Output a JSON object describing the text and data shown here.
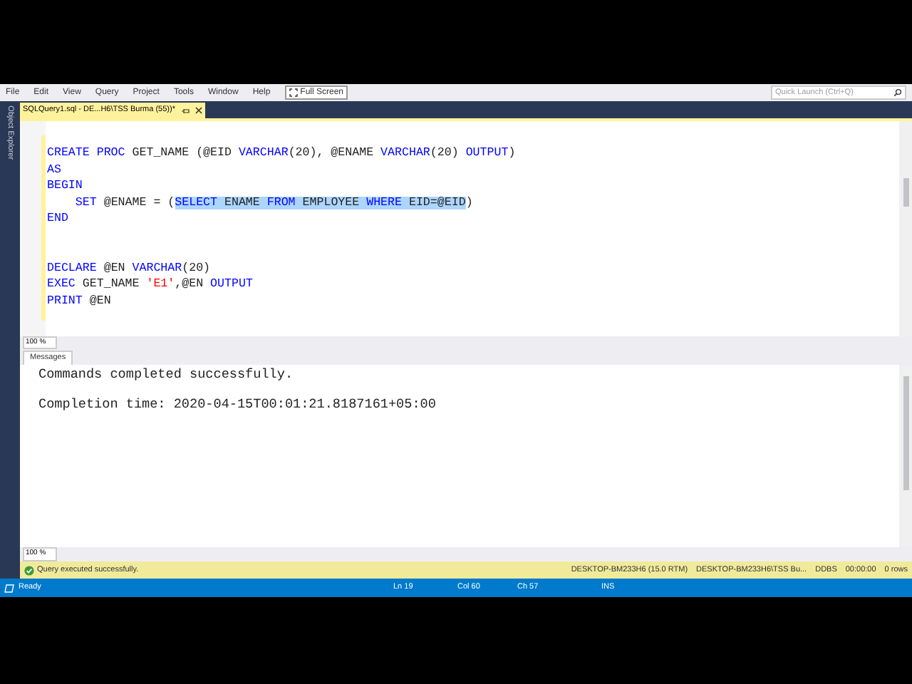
{
  "menu": [
    "File",
    "Edit",
    "View",
    "Query",
    "Project",
    "Tools",
    "Window",
    "Help"
  ],
  "full_screen_button": "Full Screen",
  "quick_launch": {
    "placeholder": "Quick Launch (Ctrl+Q)"
  },
  "side_tab": "Object Explorer",
  "document_tab": {
    "title": "SQLQuery1.sql - DE...H6\\TSS Burma (55))*",
    "selected": true
  },
  "editor_lines": [
    {
      "kind": "code",
      "tokens": [
        {
          "t": "CREATE PROC",
          "kind": "kw"
        },
        {
          "t": " GET_NAME (@EID ",
          "kind": "plain"
        },
        {
          "t": "VARCHAR",
          "kind": "kw"
        },
        {
          "t": "(20), @ENAME ",
          "kind": "plain"
        },
        {
          "t": "VARCHAR",
          "kind": "kw"
        },
        {
          "t": "(20) ",
          "kind": "plain"
        },
        {
          "t": "OUTPUT",
          "kind": "kw"
        },
        {
          "t": ")",
          "kind": "plain"
        }
      ]
    },
    {
      "kind": "code",
      "tokens": [
        {
          "t": "AS",
          "kind": "kw"
        }
      ]
    },
    {
      "kind": "code",
      "tokens": [
        {
          "t": "BEGIN",
          "kind": "kw"
        }
      ]
    },
    {
      "kind": "code",
      "tokens": [
        {
          "t": "    SET",
          "kind": "kw"
        },
        {
          "t": " @ENAME = (",
          "kind": "plain"
        },
        {
          "t": "SELECT",
          "kind": "kw",
          "selected": true
        },
        {
          "t": " ENAME ",
          "kind": "plain",
          "selected": true
        },
        {
          "t": "FROM",
          "kind": "kw",
          "selected": true
        },
        {
          "t": " EMPLOYEE ",
          "kind": "plain",
          "selected": true
        },
        {
          "t": "WHERE",
          "kind": "kw",
          "selected": true
        },
        {
          "t": " EID=@EID",
          "kind": "plain",
          "selected": true
        },
        {
          "t": ")",
          "kind": "plain"
        }
      ]
    },
    {
      "kind": "code",
      "tokens": [
        {
          "t": "END",
          "kind": "kw"
        }
      ]
    },
    {
      "kind": "blank"
    },
    {
      "kind": "blank"
    },
    {
      "kind": "code",
      "tokens": [
        {
          "t": "DECLARE",
          "kind": "kw"
        },
        {
          "t": " @EN ",
          "kind": "plain"
        },
        {
          "t": "VARCHAR",
          "kind": "kw"
        },
        {
          "t": "(20)",
          "kind": "plain"
        }
      ]
    },
    {
      "kind": "code",
      "tokens": [
        {
          "t": "EXEC",
          "kind": "kw"
        },
        {
          "t": " GET_NAME ",
          "kind": "plain"
        },
        {
          "t": "'E1'",
          "kind": "str"
        },
        {
          "t": ",@EN ",
          "kind": "plain"
        },
        {
          "t": "OUTPUT",
          "kind": "kw"
        }
      ]
    },
    {
      "kind": "code",
      "tokens": [
        {
          "t": "PRINT",
          "kind": "kw"
        },
        {
          "t": " @EN",
          "kind": "plain"
        }
      ]
    }
  ],
  "editor_zoom": "100 %",
  "results_tab": "Messages",
  "messages": [
    "Commands completed successfully.",
    "Completion time: 2020-04-15T00:01:21.8187161+05:00"
  ],
  "results_zoom": "100 %",
  "query_status": {
    "message": "Query executed successfully.",
    "server": "DESKTOP-BM233H6 (15.0 RTM)",
    "connection": "DESKTOP-BM233H6\\TSS Bu...",
    "database": "DDBS",
    "elapsed": "00:00:00",
    "rows": "0 rows"
  },
  "status_bar": {
    "state": "Ready",
    "line": "Ln 19",
    "column": "Col 60",
    "char": "Ch 57",
    "mode": "INS"
  }
}
